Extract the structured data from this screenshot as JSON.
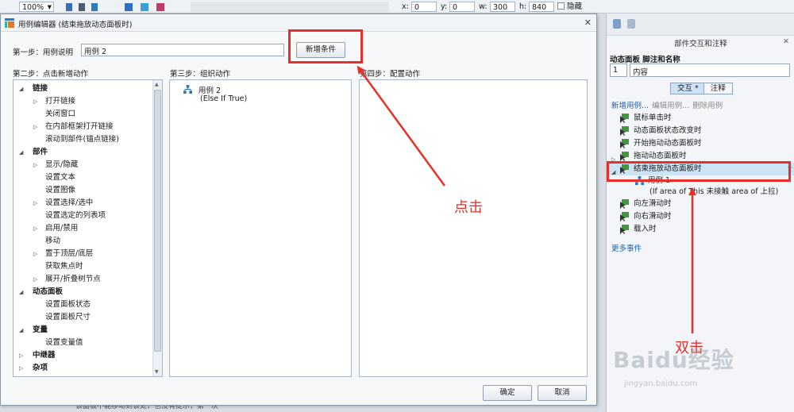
{
  "toolbar": {
    "zoom": "100%",
    "x_label": "x:",
    "x_value": "0",
    "y_label": "y:",
    "y_value": "0",
    "w_label": "w:",
    "w_value": "300",
    "h_label": "h:",
    "h_value": "840",
    "hide_label": "隐藏"
  },
  "dialog": {
    "title": "用例编辑器 (结束拖放动态面板时)",
    "step1_label": "第一步：用例说明",
    "case_description": "用例 2",
    "add_condition_button": "新增条件",
    "step2_label": "第二步：点击新增动作",
    "step3_label": "第三步：组织动作",
    "step4_label": "第四步：配置动作",
    "actions_tree": [
      {
        "label": "链接",
        "level": 0,
        "toggle": "◢",
        "bold": true
      },
      {
        "label": "打开链接",
        "level": 1,
        "toggle": "▷"
      },
      {
        "label": "关闭窗口",
        "level": 1,
        "toggle": ""
      },
      {
        "label": "在内部框架打开链接",
        "level": 1,
        "toggle": "▷"
      },
      {
        "label": "滚动到部件(锚点链接)",
        "level": 1,
        "toggle": ""
      },
      {
        "label": "部件",
        "level": 0,
        "toggle": "◢",
        "bold": true
      },
      {
        "label": "显示/隐藏",
        "level": 1,
        "toggle": "▷"
      },
      {
        "label": "设置文本",
        "level": 1,
        "toggle": ""
      },
      {
        "label": "设置图像",
        "level": 1,
        "toggle": ""
      },
      {
        "label": "设置选择/选中",
        "level": 1,
        "toggle": "▷"
      },
      {
        "label": "设置选定的列表项",
        "level": 1,
        "toggle": ""
      },
      {
        "label": "启用/禁用",
        "level": 1,
        "toggle": "▷"
      },
      {
        "label": "移动",
        "level": 1,
        "toggle": ""
      },
      {
        "label": "置于顶层/底层",
        "level": 1,
        "toggle": "▷"
      },
      {
        "label": "获取焦点时",
        "level": 1,
        "toggle": ""
      },
      {
        "label": "展开/折叠树节点",
        "level": 1,
        "toggle": "▷"
      },
      {
        "label": "动态面板",
        "level": 0,
        "toggle": "◢",
        "bold": true
      },
      {
        "label": "设置面板状态",
        "level": 1,
        "toggle": ""
      },
      {
        "label": "设置面板尺寸",
        "level": 1,
        "toggle": ""
      },
      {
        "label": "变量",
        "level": 0,
        "toggle": "◢",
        "bold": true
      },
      {
        "label": "设置变量值",
        "level": 1,
        "toggle": ""
      },
      {
        "label": "中继器",
        "level": 0,
        "toggle": "▷",
        "bold": true
      },
      {
        "label": "杂项",
        "level": 0,
        "toggle": "▷",
        "bold": true
      }
    ],
    "organized_case_name": "用例 2",
    "organized_case_condition": "(Else If True)",
    "ok_button": "确定",
    "cancel_button": "取消"
  },
  "panel": {
    "title": "部件交互和注释",
    "section_label": "动态面板 脚注和名称",
    "footnote_number": "1",
    "widget_name": "内容",
    "tab_interactions": "交互 *",
    "tab_notes": "注释",
    "link_new_case": "新增用例...",
    "link_edit_case": "编辑用例...",
    "link_delete_case": "删除用例",
    "events": [
      {
        "label": "鼠标单击时",
        "toggle": ""
      },
      {
        "label": "动态面板状态改变时",
        "toggle": ""
      },
      {
        "label": "开始拖动动态面板时",
        "toggle": ""
      },
      {
        "label": "拖动动态面板时",
        "toggle": "▷"
      },
      {
        "label": "结束拖放动态面板时",
        "toggle": "◢",
        "selected": true
      }
    ],
    "selected_case_name": "用例 1",
    "selected_case_condition": "(If area of This 未接触 area of 上拉)",
    "events_after": [
      {
        "label": "向左滑动时"
      },
      {
        "label": "向右滑动时"
      },
      {
        "label": "载入时"
      }
    ],
    "more_events": "更多事件"
  },
  "annotations": {
    "click_note": "点击",
    "double_click_note": "双击",
    "color": "#e8302b"
  },
  "watermark": {
    "brand": "Baidu经验",
    "url": "jingyan.baidu.com"
  },
  "background_text": "该面板不能移动到该处，也没有提示，第一次"
}
